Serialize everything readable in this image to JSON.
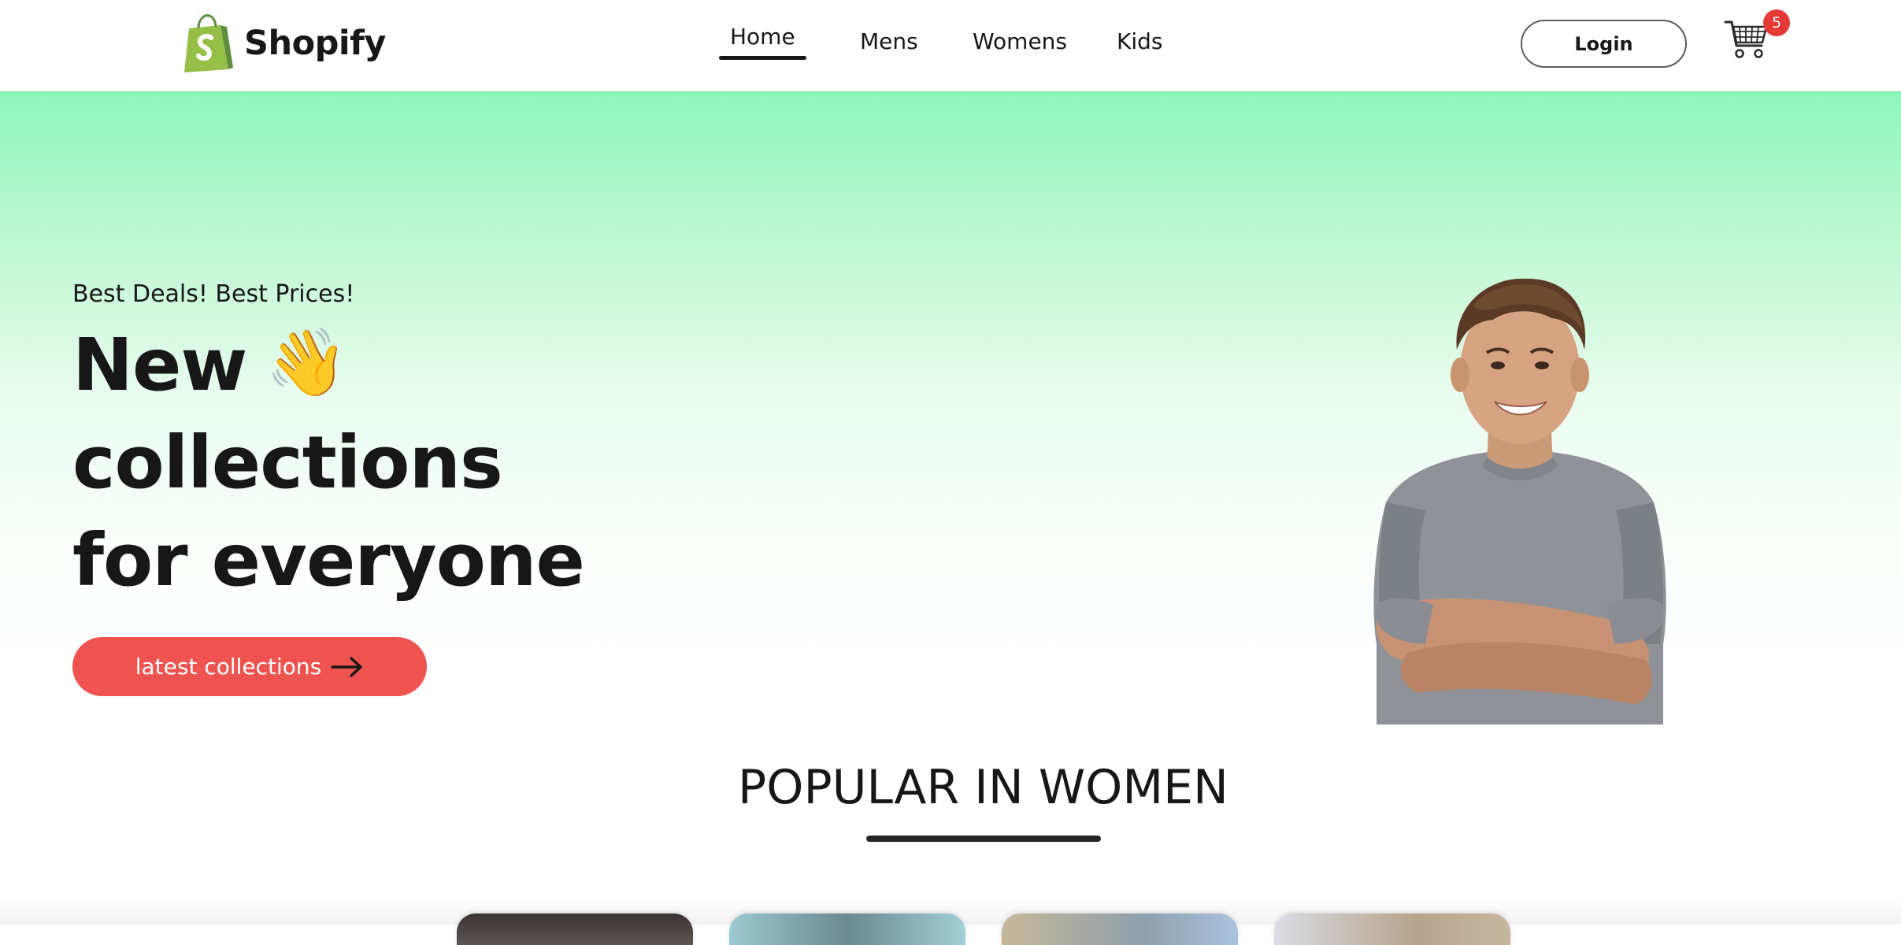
{
  "brand": {
    "name": "Shopify",
    "logo_icon": "shopping-bag-logo-icon",
    "logo_color": "#95bf47"
  },
  "nav": {
    "items": [
      {
        "label": "Home",
        "active": true
      },
      {
        "label": "Mens",
        "active": false
      },
      {
        "label": "Womens",
        "active": false
      },
      {
        "label": "Kids",
        "active": false
      }
    ]
  },
  "header": {
    "login_label": "Login",
    "cart_icon": "shopping-cart-icon",
    "cart_count": "5",
    "badge_color": "#e53935"
  },
  "hero": {
    "subtitle": "Best Deals! Best Prices!",
    "title_lines": [
      "New",
      "collections",
      "for everyone"
    ],
    "wave_emoji": "👋",
    "cta_label": "latest collections",
    "cta_icon": "arrow-right-icon",
    "cta_color": "#ef5350",
    "gradient_top": "#8ef7bb",
    "gradient_bottom": "#ffffff",
    "image": "smiling-man-crossed-arms"
  },
  "popular": {
    "title": "POPULAR IN WOMEN"
  }
}
